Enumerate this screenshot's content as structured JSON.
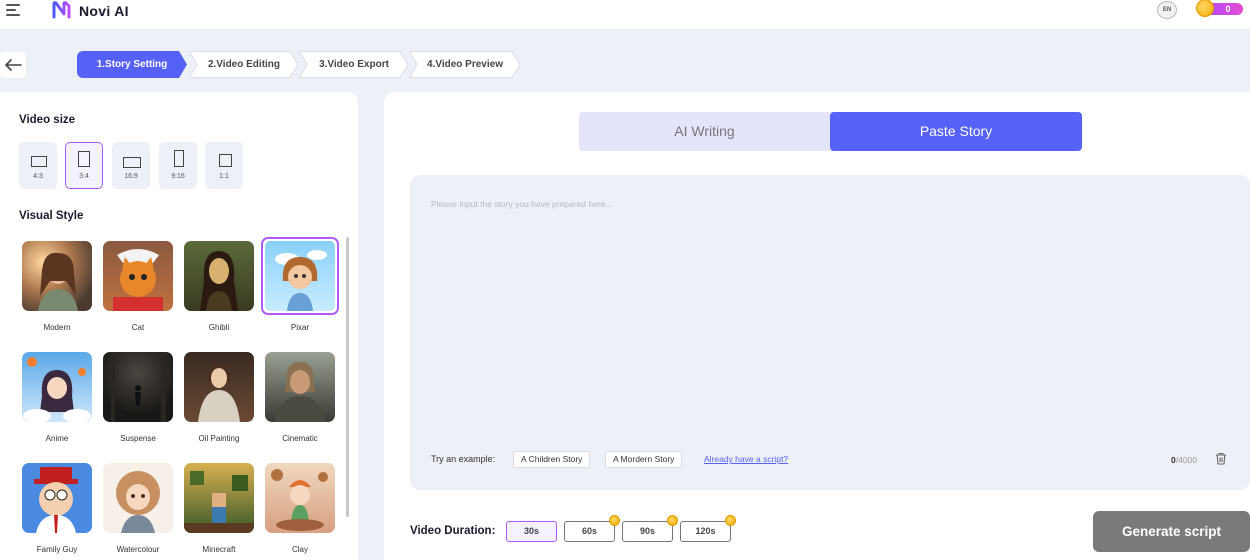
{
  "app": {
    "name": "Novi AI",
    "language": "EN",
    "credits": "0"
  },
  "colors": {
    "accent": "#5561f7",
    "selected_border": "#b15af5",
    "panel_bg": "#eef0f7"
  },
  "steps": [
    {
      "label": "1.Story Setting",
      "active": true
    },
    {
      "label": "2.Video Editing",
      "active": false
    },
    {
      "label": "3.Video Export",
      "active": false
    },
    {
      "label": "4.Video Preview",
      "active": false
    }
  ],
  "left": {
    "video_size_title": "Video size",
    "video_sizes": [
      {
        "ratio": "4:3",
        "selected": false
      },
      {
        "ratio": "3:4",
        "selected": true
      },
      {
        "ratio": "16:9",
        "selected": false
      },
      {
        "ratio": "9:16",
        "selected": false
      },
      {
        "ratio": "1:1",
        "selected": false
      }
    ],
    "visual_style_title": "Visual Style",
    "styles": [
      {
        "label": "Modern",
        "selected": false
      },
      {
        "label": "Cat",
        "selected": false
      },
      {
        "label": "Ghibli",
        "selected": false
      },
      {
        "label": "Pixar",
        "selected": true
      },
      {
        "label": "Anime",
        "selected": false
      },
      {
        "label": "Suspense",
        "selected": false
      },
      {
        "label": "Oil Painting",
        "selected": false
      },
      {
        "label": "Cinematic",
        "selected": false
      },
      {
        "label": "Family Guy",
        "selected": false
      },
      {
        "label": "Watercolour",
        "selected": false
      },
      {
        "label": "Minecraft",
        "selected": false
      },
      {
        "label": "Clay",
        "selected": false
      }
    ]
  },
  "right": {
    "tabs": [
      {
        "label": "AI Writing",
        "active": false
      },
      {
        "label": "Paste Story",
        "active": true
      }
    ],
    "story_placeholder": "Please input the story you have prepared here...",
    "try_example_label": "Try an example:",
    "examples": [
      "A Children Story",
      "A Mordern Story"
    ],
    "script_link": "Already have a script?",
    "char_count": "0",
    "char_max": "/4000",
    "duration_label": "Video Duration:",
    "durations": [
      {
        "label": "30s",
        "selected": true,
        "premium": false
      },
      {
        "label": "60s",
        "selected": false,
        "premium": true
      },
      {
        "label": "90s",
        "selected": false,
        "premium": true
      },
      {
        "label": "120s",
        "selected": false,
        "premium": true
      }
    ],
    "generate_label": "Generate script"
  }
}
